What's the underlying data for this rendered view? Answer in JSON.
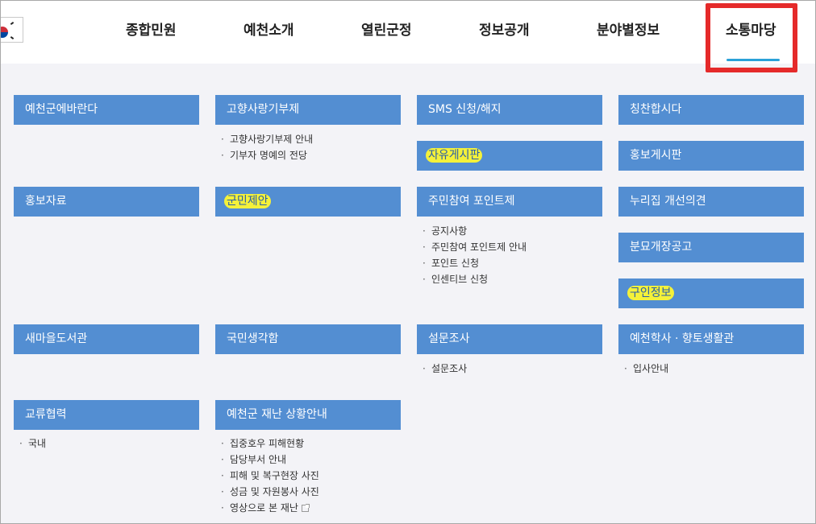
{
  "nav": {
    "items": [
      "종합민원",
      "예천소개",
      "열린군정",
      "정보공개",
      "분야별정보",
      "소통마당"
    ],
    "active": "소통마당"
  },
  "menu": {
    "c1": {
      "title": "예천군에바란다"
    },
    "c2": {
      "title": "고향사랑기부제",
      "items": [
        "고향사랑기부제 안내",
        "기부자 명예의 전당"
      ]
    },
    "c3": {
      "title": "SMS 신청/해지"
    },
    "c4": {
      "title": "칭찬합시다"
    },
    "c5": {
      "title": "자유게시판"
    },
    "c6": {
      "title": "홍보게시판"
    },
    "c7": {
      "title": "홍보자료"
    },
    "c8": {
      "title": "군민제안"
    },
    "c9": {
      "title": "주민참여 포인트제",
      "items": [
        "공지사항",
        "주민참여 포인트제 안내",
        "포인트 신청",
        "인센티브 신청"
      ]
    },
    "c10": {
      "title": "누리집 개선의견"
    },
    "c11": {
      "title": "분묘개장공고"
    },
    "c12": {
      "title": "구인정보"
    },
    "c13": {
      "title": "새마을도서관"
    },
    "c14": {
      "title": "국민생각함"
    },
    "c15": {
      "title": "설문조사",
      "items": [
        "설문조사"
      ]
    },
    "c16": {
      "title": "예천학사 · 향토생활관",
      "items": [
        "입사안내"
      ]
    },
    "c17": {
      "title": "교류협력",
      "items": [
        "국내"
      ]
    },
    "c18": {
      "title": "예천군 재난 상황안내",
      "items": [
        "집중호우 피해현황",
        "담당부서 안내",
        "피해 및 복구현장 사진",
        "성금 및 자원봉사 사진",
        "영상으로 본 재난"
      ]
    }
  },
  "colors": {
    "category_bg": "#538ed2",
    "highlight": "#f4f13a",
    "active_underline": "#2aa1d8",
    "annotation_box": "#e52a2a"
  }
}
